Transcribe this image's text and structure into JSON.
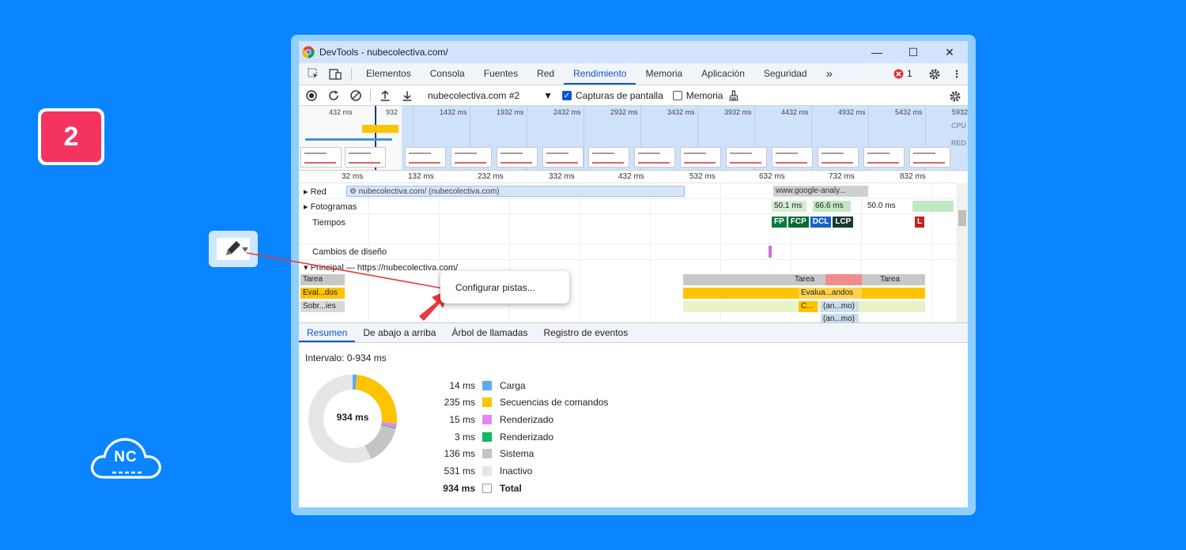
{
  "step_number": "2",
  "brand": {
    "logo_text": "NC"
  },
  "window": {
    "title": "DevTools - nubecolectiva.com/",
    "minimize": "—",
    "maximize": "☐",
    "close": "✕"
  },
  "tabs": [
    {
      "label": "Elementos"
    },
    {
      "label": "Consola"
    },
    {
      "label": "Fuentes"
    },
    {
      "label": "Red"
    },
    {
      "label": "Rendimiento"
    },
    {
      "label": "Memoria"
    },
    {
      "label": "Aplicación"
    },
    {
      "label": "Seguridad"
    }
  ],
  "tabs_overflow": "»",
  "errors": {
    "count": "1"
  },
  "perf_toolbar": {
    "profile": "nubecolectiva.com #2",
    "screenshots_label": "Capturas de pantalla",
    "screenshots_checked": true,
    "memory_label": "Memoria",
    "memory_checked": false
  },
  "overview": {
    "ticks": [
      "432 ms",
      "932",
      "1432 ms",
      "1932 ms",
      "2432 ms",
      "2932 ms",
      "3432 ms",
      "3932 ms",
      "4432 ms",
      "4932 ms",
      "5432 ms",
      "5932"
    ],
    "cpu_label": "CPU",
    "net_label": "RED"
  },
  "timeline": {
    "ruler": [
      "32 ms",
      "132 ms",
      "232 ms",
      "332 ms",
      "432 ms",
      "532 ms",
      "632 ms",
      "732 ms",
      "832 ms"
    ],
    "tracks": {
      "network": "Red",
      "frames": "Fotogramas",
      "timings": "Tiempos",
      "layout_shifts": "Cambios de diseño",
      "main": "Principal — https://nubecolectiva.com/"
    },
    "network_bar_1": "nubecolectiva.com/ (nubecolectiva.com)",
    "network_bar_2": "www.google-analy...",
    "frame_times": [
      "50.1 ms",
      "66.6 ms",
      "50.0 ms"
    ],
    "markers": [
      "FP",
      "FCP",
      "DCL",
      "LCP",
      "L"
    ],
    "main_rows": {
      "task": "Tarea",
      "evaluate": "Eval...dos",
      "override": "Sobr...ies",
      "task_right_1": "Tarea",
      "task_right_2": "Tarea",
      "evaluate_right": "Evalua...andos",
      "c_right": "C...",
      "anon_1": "(an...mo)",
      "anon_2": "(an...mo)"
    }
  },
  "context_menu": {
    "item": "Configurar pistas..."
  },
  "bottom_tabs": [
    "Resumen",
    "De abajo a arriba",
    "Árbol de llamadas",
    "Registro de eventos"
  ],
  "summary": {
    "interval": "Intervalo: 0-934 ms",
    "center_label": "934 ms",
    "rows": [
      {
        "value": "14 ms",
        "label": "Carga",
        "color": "#5ea9f2"
      },
      {
        "value": "235 ms",
        "label": "Secuencias de comandos",
        "color": "#ffc300"
      },
      {
        "value": "15 ms",
        "label": "Renderizado",
        "color": "#e288f0"
      },
      {
        "value": "3 ms",
        "label": "Renderizado",
        "color": "#0fb863"
      },
      {
        "value": "136 ms",
        "label": "Sistema",
        "color": "#c4c4c4"
      },
      {
        "value": "531 ms",
        "label": "Inactivo",
        "color": "#e6e6e6"
      },
      {
        "value": "934 ms",
        "label": "Total",
        "color": "#ffffff"
      }
    ]
  },
  "colors": {
    "background": "#0a84ff",
    "accent": "#0b57d0",
    "badge": "#f4345f",
    "arrow": "#e9393f"
  }
}
